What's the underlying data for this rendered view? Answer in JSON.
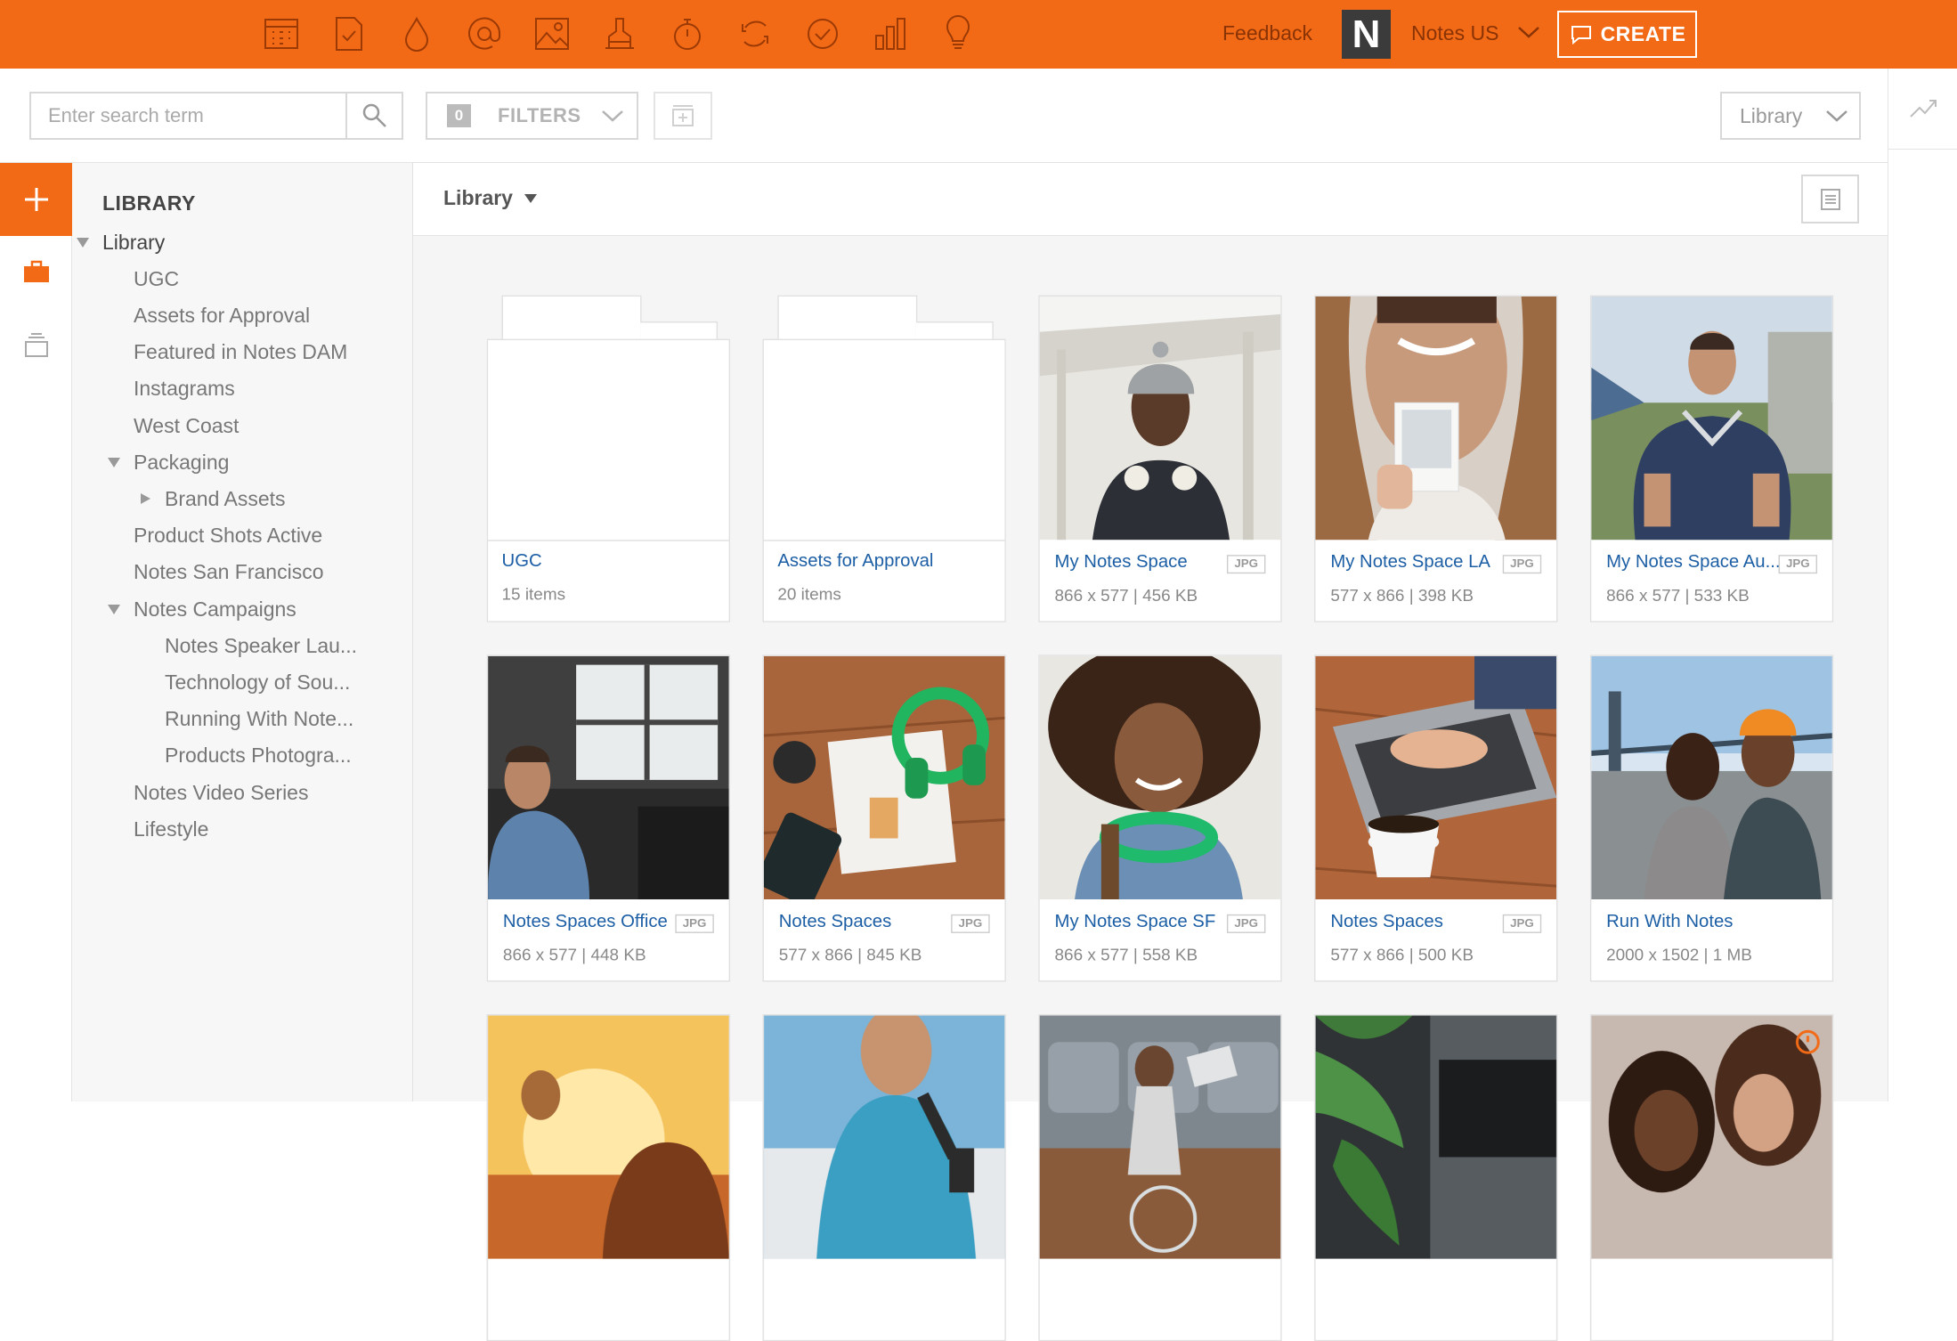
{
  "topbar": {
    "icons": [
      "calendar-icon",
      "task-icon",
      "drop-icon",
      "at-icon",
      "image-icon",
      "stamp-icon",
      "stopwatch-icon",
      "refresh-icon",
      "check-circle-icon",
      "bar-chart-icon",
      "lightbulb-icon"
    ],
    "feedback": "Feedback",
    "logo_letter": "N",
    "workspace": "Notes US",
    "create_label": "CREATE",
    "accent": "#f36a16"
  },
  "toolbar": {
    "search_placeholder": "Enter search term",
    "filter_count": "0",
    "filters_label": "FILTERS",
    "library_select": "Library"
  },
  "sidebar": {
    "title": "LIBRARY",
    "items": [
      {
        "label": "Library",
        "level": 0,
        "toggle": "expanded"
      },
      {
        "label": "UGC",
        "level": 1,
        "toggle": "none"
      },
      {
        "label": "Assets for Approval",
        "level": 1,
        "toggle": "none"
      },
      {
        "label": "Featured in Notes DAM",
        "level": 1,
        "toggle": "none"
      },
      {
        "label": "Instagrams",
        "level": 1,
        "toggle": "none"
      },
      {
        "label": "West Coast",
        "level": 1,
        "toggle": "none"
      },
      {
        "label": "Packaging",
        "level": 1,
        "toggle": "expanded"
      },
      {
        "label": "Brand Assets",
        "level": 2,
        "toggle": "collapsed"
      },
      {
        "label": "Product Shots Active",
        "level": 1,
        "toggle": "none"
      },
      {
        "label": "Notes San Francisco",
        "level": 1,
        "toggle": "none"
      },
      {
        "label": "Notes Campaigns",
        "level": 1,
        "toggle": "expanded"
      },
      {
        "label": "Notes Speaker Lau...",
        "level": 2,
        "toggle": "none"
      },
      {
        "label": "Technology of Sou...",
        "level": 2,
        "toggle": "none"
      },
      {
        "label": "Running With Note...",
        "level": 2,
        "toggle": "none"
      },
      {
        "label": "Products Photogra...",
        "level": 2,
        "toggle": "none"
      },
      {
        "label": "Notes Video Series",
        "level": 1,
        "toggle": "none"
      },
      {
        "label": "Lifestyle",
        "level": 1,
        "toggle": "none"
      }
    ]
  },
  "main": {
    "breadcrumb": "Library",
    "cards": [
      {
        "kind": "folder",
        "title": "UGC",
        "meta": "15 items"
      },
      {
        "kind": "folder",
        "title": "Assets for Approval",
        "meta": "20 items"
      },
      {
        "kind": "image",
        "title": "My Notes Space",
        "type": "JPG",
        "meta": "866 x 577 | 456 KB",
        "scene": "portrait-beanie"
      },
      {
        "kind": "image",
        "title": "My Notes Space LA",
        "type": "JPG",
        "meta": "577 x 866 | 398 KB",
        "scene": "polaroid"
      },
      {
        "kind": "image",
        "title": "My Notes Space Au...",
        "type": "JPG",
        "meta": "866 x 577 | 533 KB",
        "scene": "runner"
      },
      {
        "kind": "image",
        "title": "Notes Spaces Office",
        "type": "JPG",
        "meta": "866 x 577 | 448 KB",
        "scene": "office"
      },
      {
        "kind": "image",
        "title": "Notes Spaces",
        "type": "JPG",
        "meta": "577 x 866 | 845 KB",
        "scene": "desk-headphones"
      },
      {
        "kind": "image",
        "title": "My Notes Space SF",
        "type": "JPG",
        "meta": "866 x 577 | 558 KB",
        "scene": "smiling-woman"
      },
      {
        "kind": "image",
        "title": "Notes Spaces",
        "type": "JPG",
        "meta": "577 x 866 | 500 KB",
        "scene": "laptop-coffee"
      },
      {
        "kind": "image",
        "title": "Run With Notes",
        "type": "",
        "meta": "2000 x 1502 | 1 MB",
        "scene": "bridge-friends"
      },
      {
        "kind": "image",
        "title": "",
        "type": "",
        "meta": "",
        "scene": "sunset"
      },
      {
        "kind": "image",
        "title": "",
        "type": "",
        "meta": "",
        "scene": "woman-top"
      },
      {
        "kind": "image",
        "title": "",
        "type": "",
        "meta": "",
        "scene": "couch"
      },
      {
        "kind": "image",
        "title": "",
        "type": "",
        "meta": "",
        "scene": "plant-keyboard"
      },
      {
        "kind": "image",
        "title": "",
        "type": "",
        "meta": "",
        "scene": "two-women"
      }
    ]
  }
}
